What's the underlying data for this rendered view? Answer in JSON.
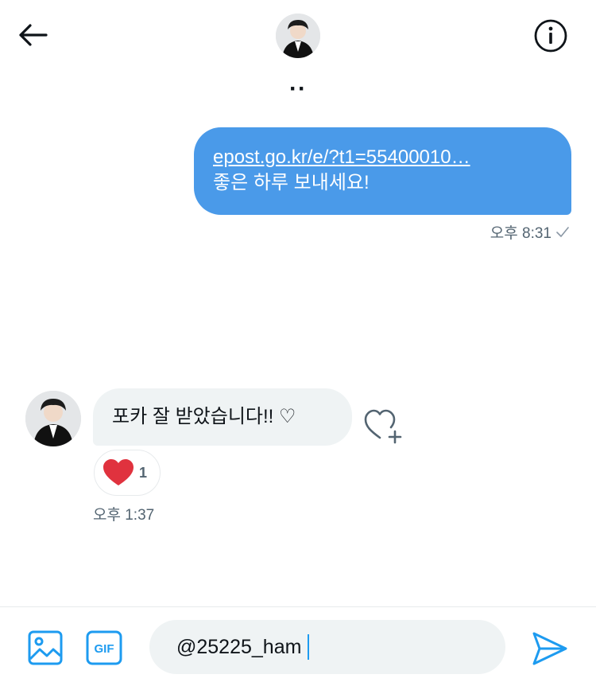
{
  "header": {
    "avatar_icon": "person-avatar",
    "dots": "··",
    "back_icon": "arrow-left-icon",
    "info_icon": "info-icon"
  },
  "messages": [
    {
      "direction": "outgoing",
      "link_text": "epost.go.kr/e/?t1=55400010…",
      "text": "좋은 하루 보내세요!",
      "time": "오후 8:31",
      "status_icon": "checkmark-icon"
    },
    {
      "direction": "incoming",
      "text": "포카 잘 받았습니다!! ♡",
      "reaction_emoji": "heart",
      "reaction_count": "1",
      "time": "오후 1:37"
    }
  ],
  "composer": {
    "input_value": "@25225_ham",
    "media_icon": "image-icon",
    "gif_label": "GIF",
    "send_icon": "send-icon"
  },
  "colors": {
    "accent": "#1d9bf0",
    "outgoing_bubble": "#4a9ae9",
    "incoming_bubble": "#eff3f4",
    "reaction_heart": "#e0323e"
  }
}
